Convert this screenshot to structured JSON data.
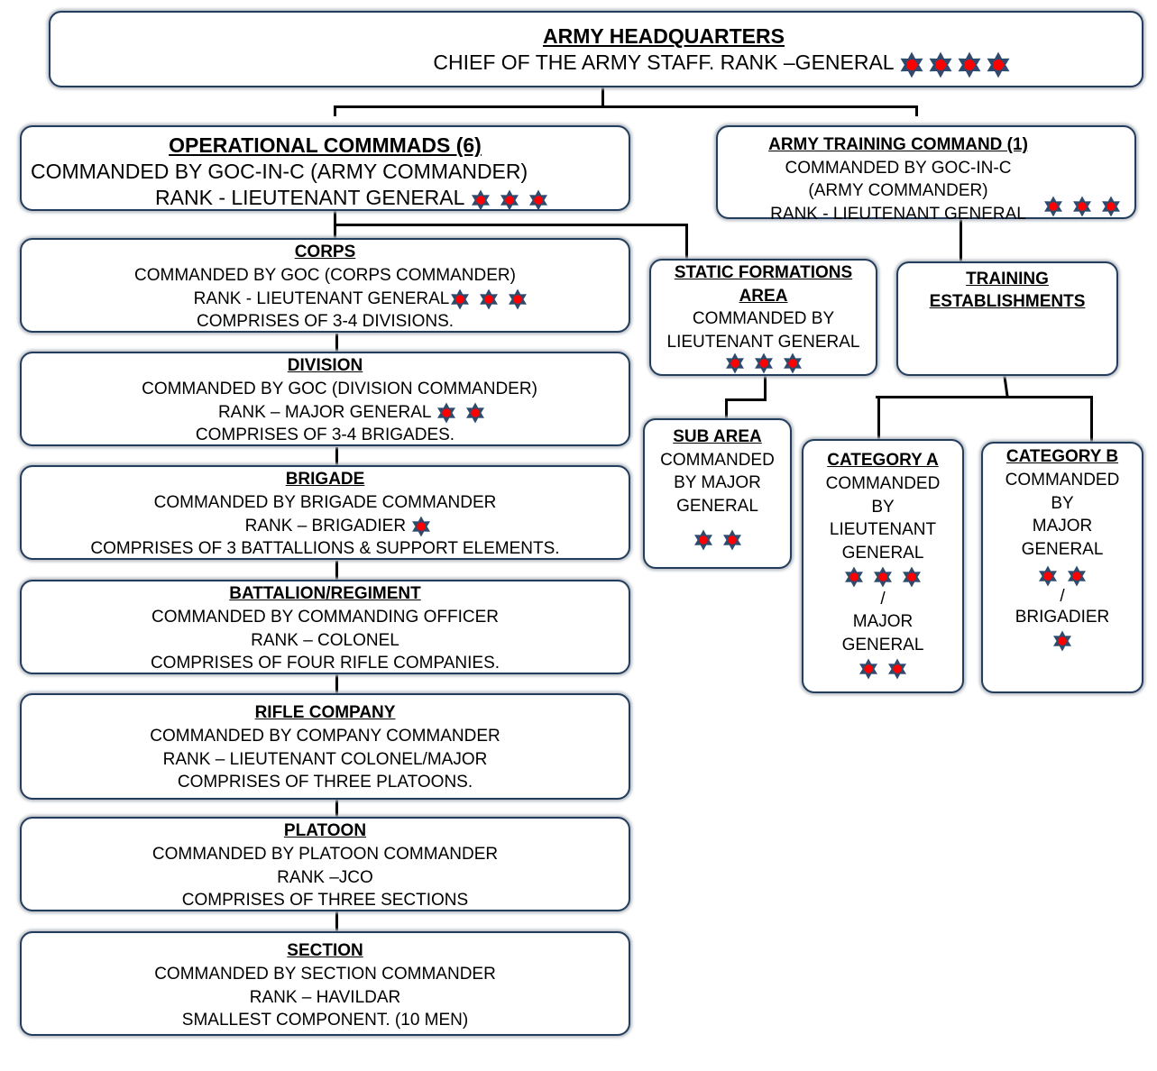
{
  "colors": {
    "border": "#233d5c",
    "star_fill": "#ff0000",
    "star_outline": "#2e4b6e",
    "connector": "#000000"
  },
  "hq": {
    "title": "ARMY HEADQUARTERS",
    "line1": "CHIEF OF THE ARMY STAFF. RANK –GENERAL",
    "stars": 4
  },
  "operational": {
    "title": "OPERATIONAL COMMMADS (6)",
    "line1": "COMMANDED BY GOC-IN-C  (ARMY COMMANDER)",
    "line2": "RANK - LIEUTENANT GENERAL",
    "stars": 3
  },
  "training_command": {
    "title": "ARMY TRAINING COMMAND (1)",
    "line1": "COMMANDED BY GOC-IN-C",
    "line2": "(ARMY COMMANDER)",
    "line3": "RANK - LIEUTENANT GENERAL",
    "stars": 3
  },
  "hierarchy": [
    {
      "title": "CORPS",
      "line1": "COMMANDED BY GOC (CORPS COMMANDER)",
      "line2": "RANK - LIEUTENANT GENERAL",
      "line3": "COMPRISES OF 3-4 DIVISIONS.",
      "stars": 3
    },
    {
      "title": "DIVISION",
      "line1": "COMMANDED BY GOC (DIVISION COMMANDER)",
      "line2": "RANK – MAJOR  GENERAL",
      "line3": "COMPRISES OF 3-4 BRIGADES.",
      "stars": 2
    },
    {
      "title": "BRIGADE",
      "line1": "COMMANDED BY BRIGADE COMMANDER",
      "line2": "RANK – BRIGADIER",
      "line3": "COMPRISES OF 3 BATTALLIONS & SUPPORT ELEMENTS.",
      "stars": 1
    },
    {
      "title": "BATTALION/REGIMENT",
      "line1": "COMMANDED BY COMMANDING OFFICER",
      "line2": "RANK – COLONEL",
      "line3": "COMPRISES OF FOUR RIFLE COMPANIES.",
      "stars": 0
    },
    {
      "title": "RIFLE COMPANY",
      "line1": "COMMANDED BY COMPANY COMMANDER",
      "line2": "RANK – LIEUTENANT COLONEL/MAJOR",
      "line3": "COMPRISES OF THREE PLATOONS.",
      "stars": 0
    },
    {
      "title": "PLATOON",
      "line1": "COMMANDED BY PLATOON COMMANDER",
      "line2": "RANK –JCO",
      "line3": "COMPRISES OF THREE SECTIONS",
      "stars": 0
    },
    {
      "title": "SECTION",
      "line1": "COMMANDED BY SECTION COMMANDER",
      "line2": "RANK – HAVILDAR",
      "line3": "SMALLEST COMPONENT. (10  MEN)",
      "stars": 0
    }
  ],
  "static_formations": {
    "title1": "STATIC  FORMATIONS",
    "title2": "AREA",
    "line1": "COMMANDED BY",
    "line2": "LIEUTENANT GENERAL",
    "stars": 3
  },
  "sub_area": {
    "title": "SUB AREA",
    "line1": "COMMANDED",
    "line2": "BY MAJOR",
    "line3": "GENERAL",
    "stars": 2
  },
  "training_establishments": {
    "title1": "TRAINING",
    "title2": "ESTABLISHMENTS"
  },
  "category_a": {
    "title": "CATEGORY  A",
    "line1": "COMMANDED",
    "line2": "BY",
    "line3": "LIEUTENANT",
    "line4": "GENERAL",
    "stars1": 3,
    "separator": "/",
    "line5": "MAJOR",
    "line6": "GENERAL",
    "stars2": 2
  },
  "category_b": {
    "title": "CATEGORY B",
    "line1": "COMMANDED",
    "line2": "BY",
    "line3": "MAJOR",
    "line4": "GENERAL",
    "stars1": 2,
    "separator": "/",
    "line5": "BRIGADIER",
    "stars2": 1
  }
}
